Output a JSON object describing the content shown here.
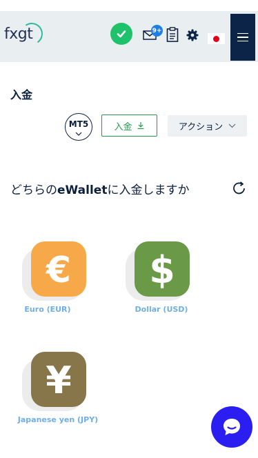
{
  "header": {
    "logo_text": "fxgt",
    "notification_count": "9+",
    "flag": "JP"
  },
  "page": {
    "title": "入金",
    "platform_label": "MT5",
    "deposit_button_label": "入金",
    "action_button_label": "アクション",
    "question_prefix": "どちらの",
    "question_bold": "eWallet",
    "question_suffix": "に入金しますか"
  },
  "currencies": [
    {
      "label": "Euro (EUR)",
      "symbol": "€",
      "color": "#f7a94a"
    },
    {
      "label": "Dollar (USD)",
      "symbol": "$",
      "color": "#6a9a48"
    },
    {
      "label": "Japanese yen (JPY)",
      "symbol": "¥",
      "color": "#87764a"
    }
  ],
  "colors": {
    "accent_green": "#1e9e48",
    "navy": "#0b2448",
    "chat_blue": "#2a1ff0",
    "verified_green": "#1ec26a",
    "badge_blue": "#1e7ee8"
  }
}
